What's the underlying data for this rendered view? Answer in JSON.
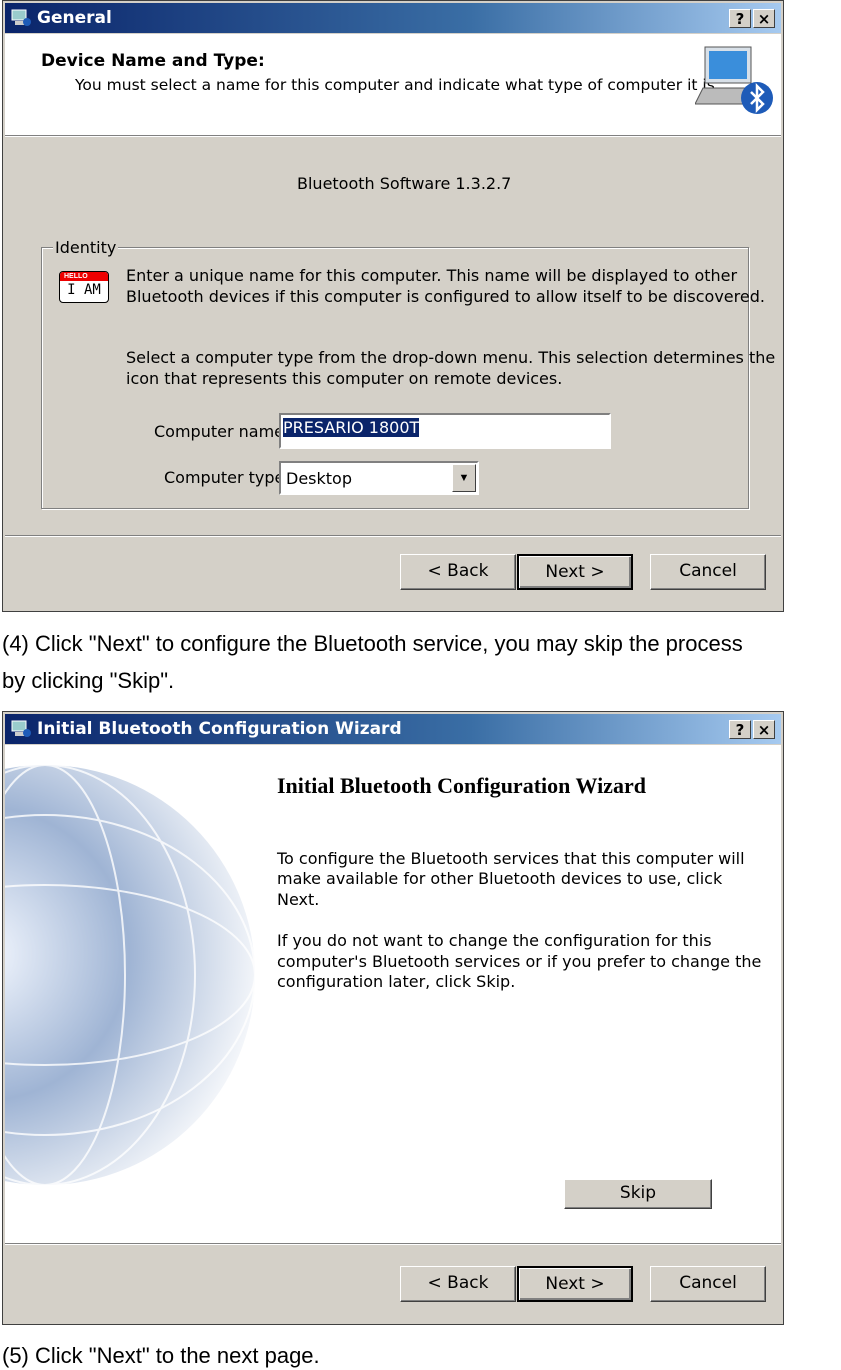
{
  "dialog1": {
    "title": "General",
    "header_title": "Device Name and Type:",
    "header_subtitle": "You must select a name for this computer and indicate what type of computer it is.",
    "version": "Bluetooth Software 1.3.2.7",
    "group_label": "Identity",
    "para1_line1": "Enter a unique name for this computer.  This name will be displayed to other",
    "para1_line2": "Bluetooth devices if this computer is configured to allow itself to be discovered.",
    "para2_line1": "Select a computer type from the drop-down menu.  This selection determines the",
    "para2_line2": "icon that represents this computer on remote devices.",
    "name_label": "Computer name:",
    "name_value": "PRESARIO 1800T",
    "type_label": "Computer type:",
    "type_value": "Desktop",
    "badge_hello": "HELLO",
    "badge_iam": "I AM",
    "help": "?",
    "close": "×",
    "back_label": "< Back",
    "next_label": "Next >",
    "cancel_label": "Cancel"
  },
  "caption1_line1": "(4) Click \"Next\" to configure the Bluetooth service, you may skip the process",
  "caption1_line2": "by clicking \"Skip\".",
  "dialog2": {
    "title": "Initial Bluetooth Configuration Wizard",
    "heading": "Initial Bluetooth Configuration Wizard",
    "p1": [
      "To configure the Bluetooth services that this computer will",
      "make available for other Bluetooth devices to use, click",
      "Next."
    ],
    "p2": [
      "If you do not want to change the configuration for this",
      "computer's Bluetooth services or if you prefer to change the",
      "configuration later, click Skip."
    ],
    "skip_label": "Skip",
    "help": "?",
    "close": "×",
    "back_label": "< Back",
    "next_label": "Next >",
    "cancel_label": "Cancel"
  },
  "caption2": "(5) Click \"Next\" to the next page."
}
